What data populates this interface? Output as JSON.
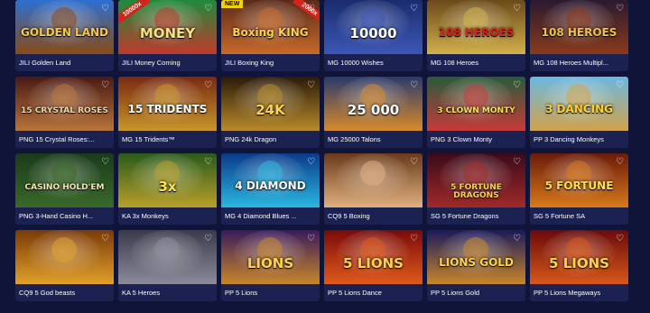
{
  "games": [
    {
      "caption": "JILI Golden Land",
      "art": "GOLDEN LAND",
      "bg": [
        "#2d6fd1",
        "#8a4b16"
      ],
      "fg": "#f6c945",
      "badge": ""
    },
    {
      "caption": "JILI Money Coming",
      "art": "MONEY",
      "bg": [
        "#1f8a3b",
        "#c0392b"
      ],
      "fg": "#f6e27a",
      "badge": "10000x"
    },
    {
      "caption": "JILI Boxing King",
      "art": "Boxing KING",
      "bg": [
        "#5a2a1a",
        "#c86a2a"
      ],
      "fg": "#ffd24a",
      "badge": "NEW",
      "badge2": "2000x"
    },
    {
      "caption": "MG 10000 Wishes",
      "art": "10000",
      "bg": [
        "#1a2c6e",
        "#3d57b5"
      ],
      "fg": "#ffffff",
      "badge": ""
    },
    {
      "caption": "MG 108 Heroes",
      "art": "108 HEROES",
      "bg": [
        "#6b4a1a",
        "#d2b04a"
      ],
      "fg": "#e0211a",
      "badge": ""
    },
    {
      "caption": "MG 108 Heroes Multipl...",
      "art": "108 HEROES",
      "bg": [
        "#2a1a30",
        "#8a3a1a"
      ],
      "fg": "#f0c24a",
      "badge": ""
    },
    {
      "caption": "PNG 15 Crystal Roses:...",
      "art": "15 CRYSTAL ROSES",
      "bg": [
        "#4a1a14",
        "#b8743a"
      ],
      "fg": "#f2d8a0",
      "badge": ""
    },
    {
      "caption": "MG 15 Tridents™",
      "art": "15 TRIDENTS",
      "bg": [
        "#7a2a10",
        "#c8962a"
      ],
      "fg": "#ffffff",
      "badge": ""
    },
    {
      "caption": "PNG 24k Dragon",
      "art": "24K",
      "bg": [
        "#2a1a08",
        "#b88a2a"
      ],
      "fg": "#ffd24a",
      "badge": ""
    },
    {
      "caption": "MG 25000 Talons",
      "art": "25 000",
      "bg": [
        "#2a3a6a",
        "#d88a2a"
      ],
      "fg": "#ffffff",
      "badge": ""
    },
    {
      "caption": "PNG 3 Clown Monty",
      "art": "3 CLOWN MONTY",
      "bg": [
        "#2a5a3a",
        "#c83a3a"
      ],
      "fg": "#ffe04a",
      "badge": ""
    },
    {
      "caption": "PP 3 Dancing Monkeys",
      "art": "3 DANCING",
      "bg": [
        "#6ab8e0",
        "#d2a24a"
      ],
      "fg": "#ffd02a",
      "badge": ""
    },
    {
      "caption": "PNG 3-Hand Casino H...",
      "art": "CASINO HOLD'EM",
      "bg": [
        "#1a3a1a",
        "#3a6a2a"
      ],
      "fg": "#f4e6b0",
      "badge": ""
    },
    {
      "caption": "KA 3x Monkeys",
      "art": "3x",
      "bg": [
        "#2a5a1a",
        "#b8a02a"
      ],
      "fg": "#ffe04a",
      "badge": ""
    },
    {
      "caption": "MG 4 Diamond Blues ...",
      "art": "4 DIAMOND",
      "bg": [
        "#0a3a8a",
        "#2ab8e0"
      ],
      "fg": "#ffffff",
      "badge": ""
    },
    {
      "caption": "CQ9 5 Boxing",
      "art": "",
      "bg": [
        "#6a3a1a",
        "#e0b080"
      ],
      "fg": "#ffffff",
      "badge": ""
    },
    {
      "caption": "SG 5 Fortune Dragons",
      "art": "5 FORTUNE DRAGONS",
      "bg": [
        "#3a0a1a",
        "#a02a2a"
      ],
      "fg": "#ffd24a",
      "badge": ""
    },
    {
      "caption": "SG 5 Fortune SA",
      "art": "5 FORTUNE",
      "bg": [
        "#6a1a0a",
        "#d87a1a"
      ],
      "fg": "#ffe04a",
      "badge": ""
    },
    {
      "caption": "CQ9 5 God beasts",
      "art": "",
      "bg": [
        "#7a3a08",
        "#e0a02a"
      ],
      "fg": "#ffd24a",
      "badge": ""
    },
    {
      "caption": "KA 5 Heroes",
      "art": "",
      "bg": [
        "#3a3a4a",
        "#8a8a9a"
      ],
      "fg": "#ffffff",
      "badge": ""
    },
    {
      "caption": "PP 5 Lions",
      "art": "LIONS",
      "bg": [
        "#3a1a5a",
        "#c8862a"
      ],
      "fg": "#ffd24a",
      "badge": ""
    },
    {
      "caption": "PP 5 Lions Dance",
      "art": "5 LIONS",
      "bg": [
        "#7a0a0a",
        "#e05a1a"
      ],
      "fg": "#ffd24a",
      "badge": ""
    },
    {
      "caption": "PP 5 Lions Gold",
      "art": "LIONS GOLD",
      "bg": [
        "#1a1a5a",
        "#c8862a"
      ],
      "fg": "#ffd24a",
      "badge": ""
    },
    {
      "caption": "PP 5 Lions Megaways",
      "art": "5 LIONS",
      "bg": [
        "#6a0a0a",
        "#d8581a"
      ],
      "fg": "#ffd24a",
      "badge": ""
    }
  ],
  "favorite_icon": "heart-outline-icon",
  "colors": {
    "page_bg": "#0f1438",
    "card_bg": "#1b2150",
    "caption": "#ffffff"
  }
}
